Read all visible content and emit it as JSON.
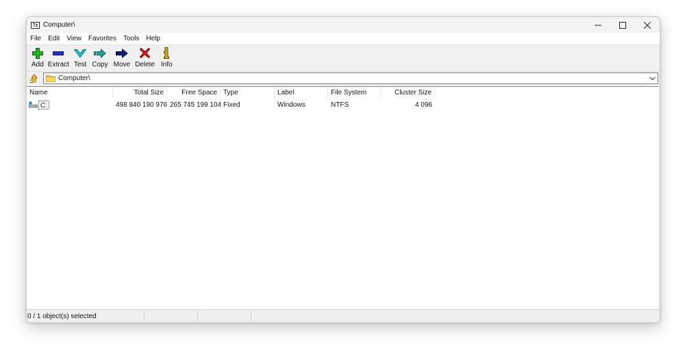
{
  "window": {
    "title": "Computer\\",
    "app_icon_text": "7z"
  },
  "menu": {
    "items": [
      "File",
      "Edit",
      "View",
      "Favorites",
      "Tools",
      "Help"
    ]
  },
  "toolbar": {
    "buttons": [
      {
        "label": "Add",
        "icon": "plus-icon",
        "color": "#22b822"
      },
      {
        "label": "Extract",
        "icon": "minus-icon",
        "color": "#1f2fd6"
      },
      {
        "label": "Test",
        "icon": "check-chevron-icon",
        "color": "#26c6d6"
      },
      {
        "label": "Copy",
        "icon": "copy-arrow-icon",
        "color": "#1aa7a0"
      },
      {
        "label": "Move",
        "icon": "move-arrow-icon",
        "color": "#0f1a7a"
      },
      {
        "label": "Delete",
        "icon": "delete-x-icon",
        "color": "#e01818"
      },
      {
        "label": "Info",
        "icon": "info-icon",
        "color": "#d9b600"
      }
    ]
  },
  "address": {
    "path": "Computer\\"
  },
  "list": {
    "columns": [
      "Name",
      "Total Size",
      "Free Space",
      "Type",
      "Label",
      "File System",
      "Cluster Size"
    ],
    "rows": [
      {
        "name": "C:",
        "total_size": "498 840 190 976",
        "free_space": "265 745 199 104",
        "type": "Fixed",
        "label": "Windows",
        "file_system": "NTFS",
        "cluster_size": "4 096"
      }
    ]
  },
  "status": {
    "text": "0 / 1 object(s) selected"
  }
}
